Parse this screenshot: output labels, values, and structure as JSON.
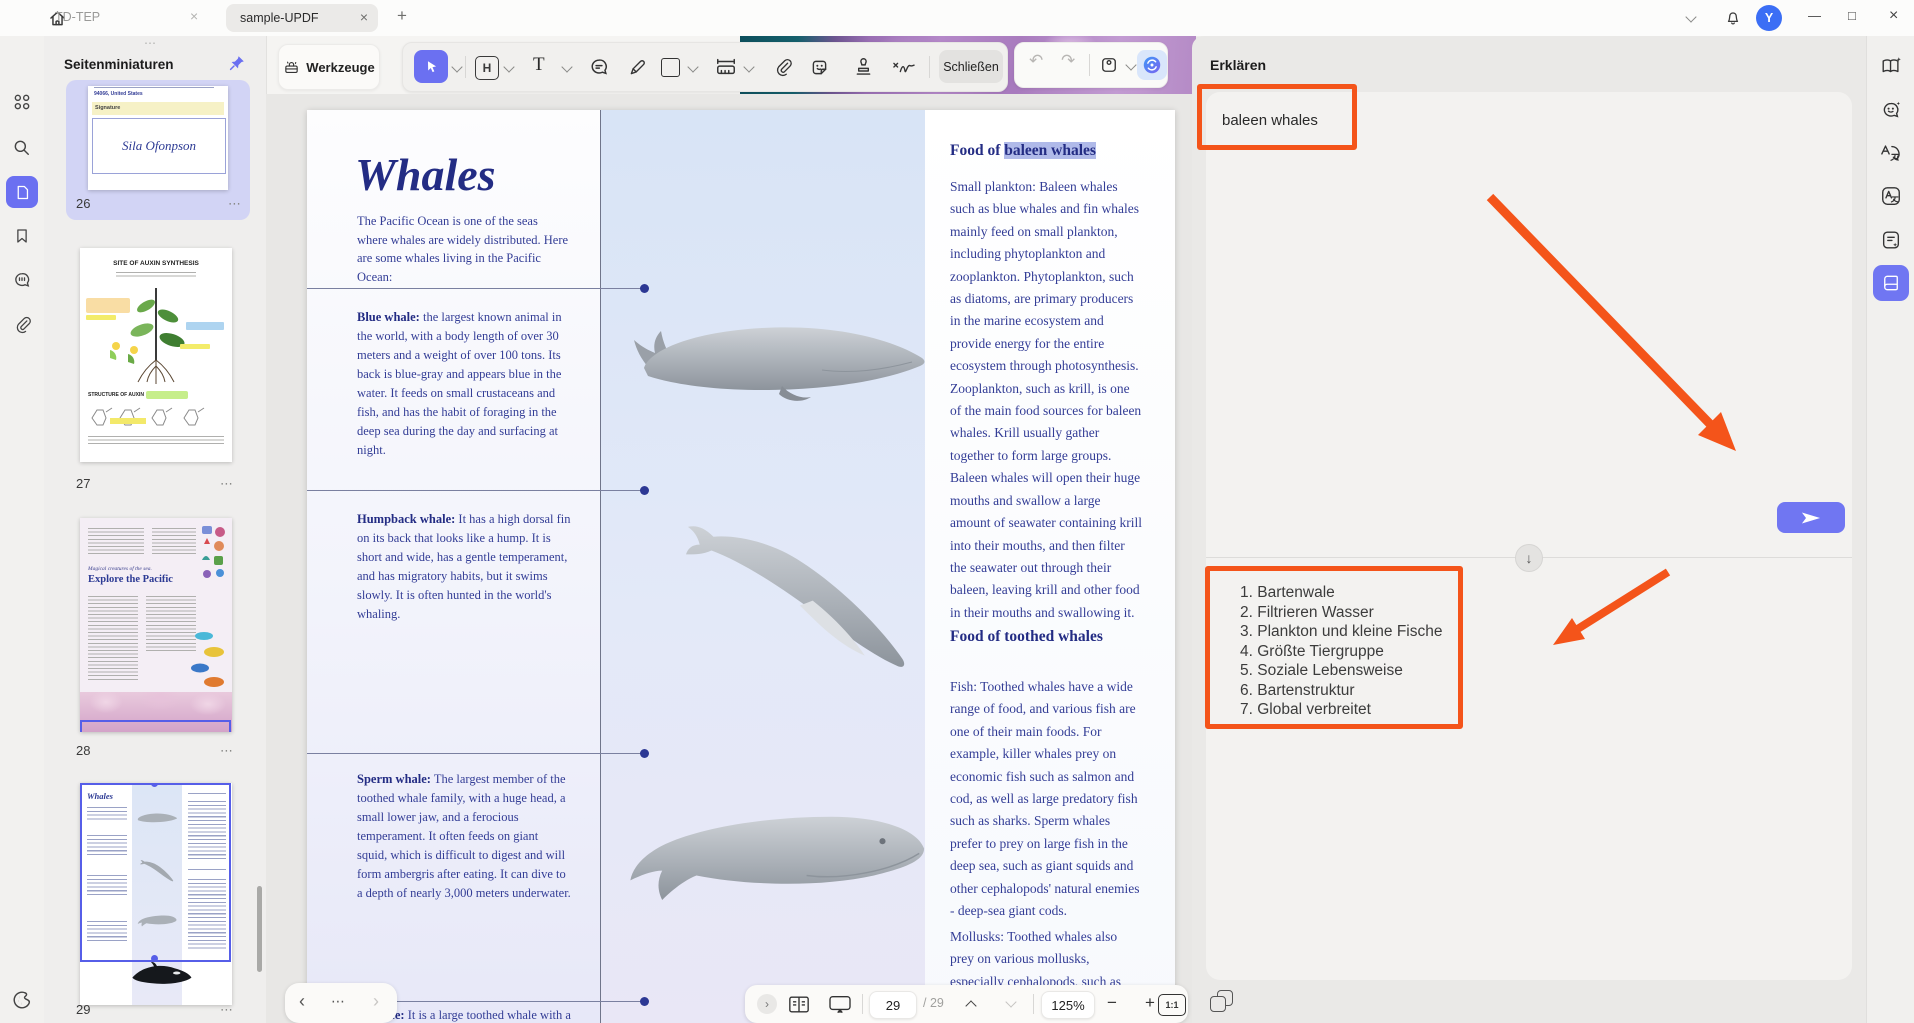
{
  "window": {
    "tabs": [
      {
        "label": "TD-TEP"
      },
      {
        "label": "sample-UPDF"
      }
    ],
    "avatar": "Y"
  },
  "icons": {
    "close": "×",
    "plus": "+",
    "minus": "−",
    "undo": "↶",
    "redo": "↷",
    "more": "⋯",
    "drag": "⋯",
    "down_arrow": "↓",
    "chevron_left": "‹",
    "chevron_right": "›",
    "minimize": "—",
    "maximize": "□",
    "one_to_one": "1:1"
  },
  "panels": {
    "thumbnails_title": "Seitenminiaturen",
    "tools_button": "Werkzeuge",
    "close_button": "Schließen",
    "ai_title": "Erklären"
  },
  "thumbnails": {
    "pages": [
      {
        "number": "26",
        "line": "94066, United States",
        "signature_label": "Signature",
        "signature_name": "Sila Ofonpson"
      },
      {
        "number": "27",
        "title": "SITE OF AUXIN SYNTHESIS",
        "subtitle": "STRUCTURE OF AUXIN"
      },
      {
        "number": "28",
        "tagline": "Magical creatures of the sea.",
        "title": "Explore the Pacific"
      },
      {
        "number": "29",
        "title": "Whales"
      }
    ]
  },
  "document": {
    "title": "Whales",
    "intro": "The Pacific Ocean is one of the seas where whales are widely distributed. Here are some whales living in the Pacific Ocean:",
    "sections": [
      {
        "label": "Blue whale:",
        "text": " the largest known animal in the world, with a body length of over 30 meters and a weight of over 100 tons. Its back is blue-gray and appears blue in the water. It feeds on small crustaceans and fish, and has the habit of foraging in the deep sea during the day and surfacing at night."
      },
      {
        "label": "Humpback whale:",
        "text": " It has a high dorsal fin on its back that looks like a hump. It is short and wide, has a gentle temperament, and has migratory habits, but it swims slowly. It is often hunted in the world's whaling."
      },
      {
        "label": "Sperm whale:",
        "text": " The largest member of the toothed whale family, with a huge head, a small lower jaw, and a ferocious temperament. It often feeds on giant squid, which is difficult to digest and will form ambergris after eating. It can dive to a depth of nearly 3,000 meters underwater."
      },
      {
        "label": "Killer whale:",
        "text": " It is a large toothed whale with a"
      }
    ],
    "right_column": {
      "heading1_prefix": "Food of ",
      "heading1_highlight": "baleen whales",
      "para1": "Small plankton: Baleen whales such as blue whales and fin whales mainly feed on small plankton, including phytoplankton and zooplankton. Phytoplankton, such as diatoms, are primary producers in the marine ecosystem and provide energy for the entire ecosystem through photosynthesis. Zooplankton, such as krill, is one of the main food sources for baleen whales. Krill usually gather together to form large groups. Baleen whales will open their huge mouths and swallow a large amount of seawater containing krill into their mouths, and then filter the seawater out through their baleen, leaving krill and other food in their mouths and swallowing it.",
      "heading2": "Food of toothed whales",
      "para2": "Fish: Toothed whales have a wide range of food, and various fish are one of their main foods. For example, killer whales prey on economic fish such as salmon and cod, as well as large predatory fish such as sharks. Sperm whales prefer to prey on large fish in the deep sea, such as giant squids and other cephalopods' natural enemies - deep-sea giant cods.",
      "para3": "Mollusks: Toothed whales also prey on various mollusks, especially cephalopods, such as squids and"
    }
  },
  "ai": {
    "query": "baleen whales",
    "results": [
      "1. Bartenwale",
      "2. Filtrieren Wasser",
      "3. Plankton und kleine Fische",
      "4. Größte Tiergruppe",
      "5. Soziale Lebensweise",
      "6. Bartenstruktur",
      "7. Global verbreitet"
    ]
  },
  "statusbar": {
    "page": "29",
    "total": "/ 29",
    "zoom": "125%"
  },
  "colors": {
    "accent": "#6b70f1",
    "annotation_orange": "#f4541a",
    "navy": "#2c3a94",
    "highlight": "#b0bae9",
    "viewport_blue": "#565ee8",
    "avatar_blue": "#3b6ef5"
  }
}
